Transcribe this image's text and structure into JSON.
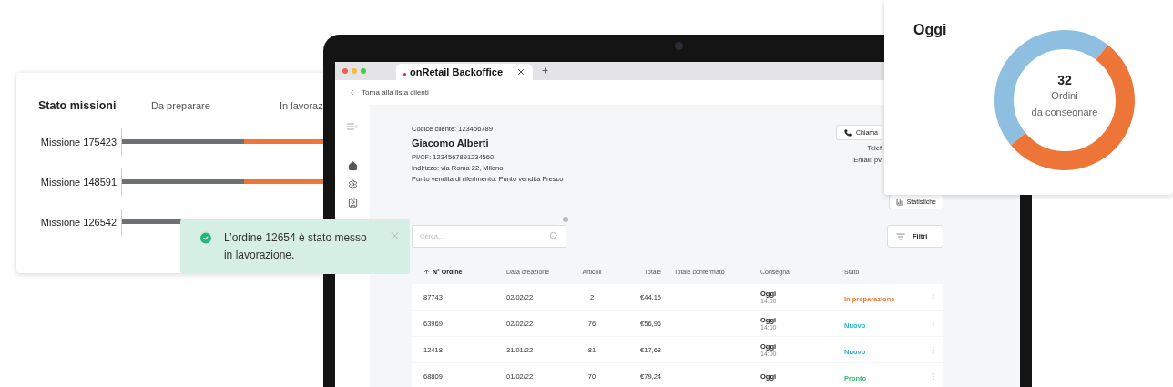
{
  "missions_card": {
    "title": "Stato missioni",
    "columns": [
      "Da preparare",
      "In lavoraz"
    ],
    "rows": [
      {
        "label": "Missione 175423"
      },
      {
        "label": "Missione 148591"
      },
      {
        "label": "Missione 126542"
      }
    ]
  },
  "toast": {
    "message": "L’ordine 12654 è stato messo in lavorazione."
  },
  "browser": {
    "tab": {
      "title": "onRetail Backoffice"
    }
  },
  "back_link": "Torna alla lista clienti",
  "customer": {
    "code": "Codice cliente: 123456789",
    "name": "Giacomo Alberti",
    "lines": [
      "PI/CF: 1234567891234560",
      "Indirizzo: via Roma 22, Milano",
      "Punto vendita di riferimento: Punto vendita Fresco"
    ],
    "call_button": "Chiama",
    "contact_lines": [
      "Telef",
      "Email: pv"
    ],
    "stats_button": "Statistiche"
  },
  "search": {
    "placeholder": "Cerca..."
  },
  "filter_button": "Filtri",
  "table": {
    "columns": [
      "N° Ordine",
      "Data creazione",
      "Articoli",
      "Totale",
      "Totale confermato",
      "Consegna",
      "Stato"
    ],
    "rows": [
      {
        "order": "87743",
        "date": "02/02/22",
        "items": "2",
        "total": "€44,15",
        "delivery": "Oggi",
        "time": "14:00",
        "status": "In preparazione",
        "color": "#e8793b"
      },
      {
        "order": "63969",
        "date": "02/02/22",
        "items": "76",
        "total": "€56,96",
        "delivery": "Oggi",
        "time": "14:00",
        "status": "Nuovo",
        "color": "#22b8c4"
      },
      {
        "order": "12418",
        "date": "31/01/22",
        "items": "81",
        "total": "€17,68",
        "delivery": "Oggi",
        "time": "14:00",
        "status": "Nuovo",
        "color": "#22b8c4"
      },
      {
        "order": "68809",
        "date": "01/02/22",
        "items": "70",
        "total": "€79,24",
        "delivery": "Oggi",
        "status": "Pronto",
        "color": "#3db46d"
      }
    ]
  },
  "today_card": {
    "title": "Oggi",
    "count": "32",
    "label_lines": [
      "Ordini",
      "da consegnare"
    ]
  }
}
